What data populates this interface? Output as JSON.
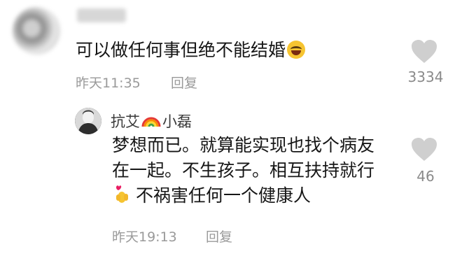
{
  "comment1": {
    "text": "可以做任何事但绝不能结婚",
    "emoji": "rolling-on-floor-laughing",
    "time": "昨天11:35",
    "reply_label": "回复",
    "like_count": "3334"
  },
  "comment2": {
    "username_part1": "抗艾",
    "username_part2": "小磊",
    "lines": [
      "梦想而已。就算能实现也找个病友",
      "在一起。不生孩子。相互扶持就行",
      "不祸害任何一个健康人"
    ],
    "time": "昨天19:13",
    "reply_label": "回复",
    "like_count": "46"
  },
  "colors": {
    "text": "#161616",
    "meta": "#9a9a9a",
    "heart": "#c9c9c9"
  }
}
